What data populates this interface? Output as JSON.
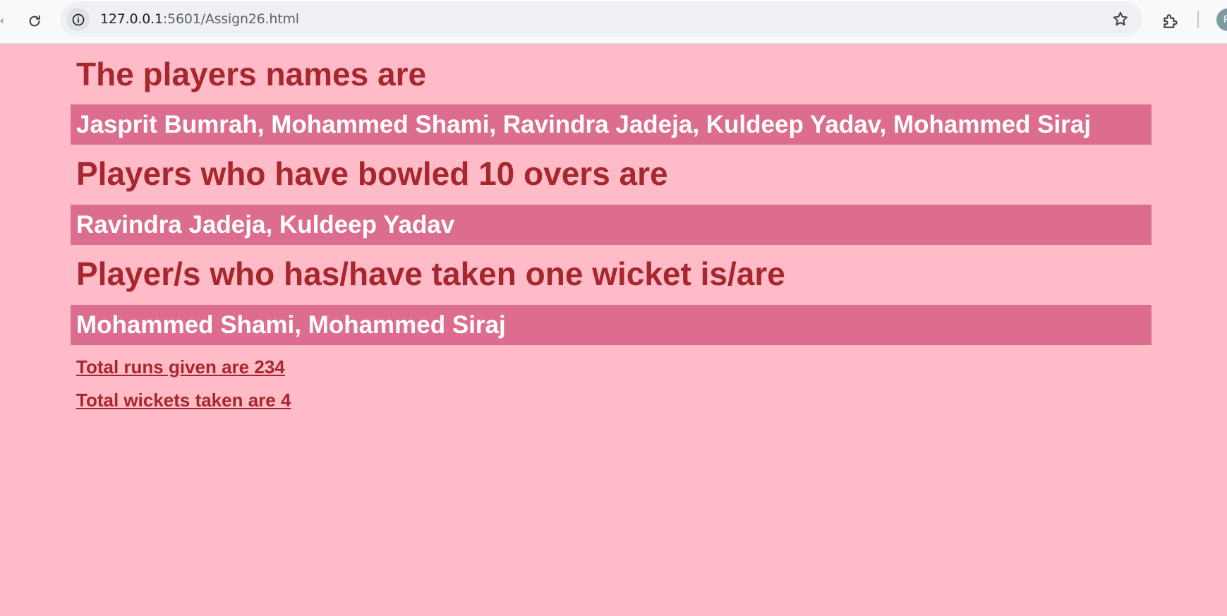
{
  "browser": {
    "url_host": "127.0.0.1",
    "url_path": ":5601/Assign26.html",
    "avatar_letter": "P"
  },
  "sections": [
    {
      "heading": "The players names are",
      "value": "Jasprit Bumrah, Mohammed Shami, Ravindra Jadeja, Kuldeep Yadav, Mohammed Siraj"
    },
    {
      "heading": "Players who have bowled 10 overs are",
      "value": "Ravindra Jadeja, Kuldeep Yadav"
    },
    {
      "heading": "Player/s who has/have taken one wicket is/are",
      "value": "Mohammed Shami, Mohammed Siraj"
    }
  ],
  "totals": {
    "runs": "Total runs given are 234",
    "wickets": "Total wickets taken are 4"
  },
  "colors": {
    "background": "#ffbcc8",
    "heading": "#a7272e",
    "band": "#dc6d8e",
    "band_text": "#ffffff"
  },
  "icons": [
    "reload-icon",
    "info-icon",
    "star-icon",
    "extensions-icon"
  ]
}
